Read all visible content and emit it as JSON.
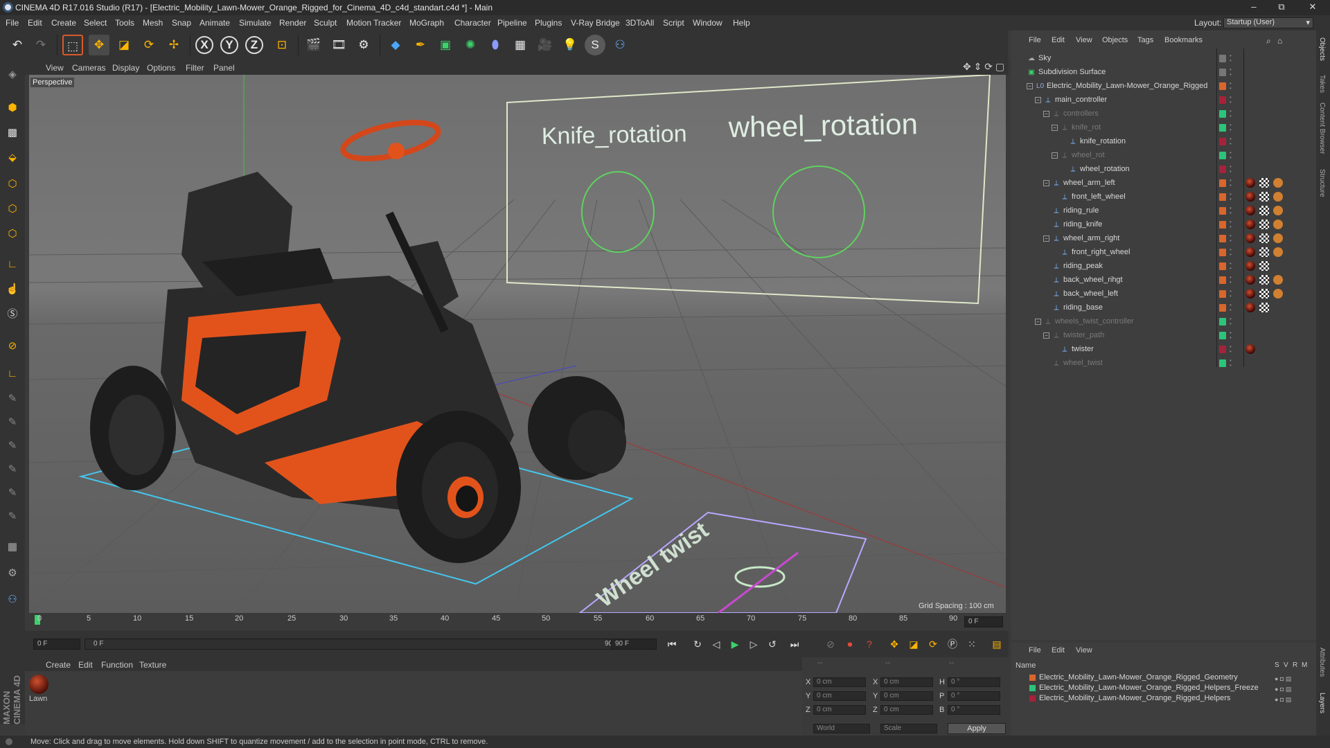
{
  "window": {
    "title": "CINEMA 4D R17.016 Studio (R17) - [Electric_Mobility_Lawn-Mower_Orange_Rigged_for_Cinema_4D_c4d_standart.c4d *] - Main",
    "minimize": "–",
    "restore": "⧉",
    "close": "✕"
  },
  "menubar": {
    "items": [
      "File",
      "Edit",
      "Create",
      "Select",
      "Tools",
      "Mesh",
      "Snap",
      "Animate",
      "Simulate",
      "Render",
      "Sculpt",
      "Motion Tracker",
      "MoGraph",
      "Character",
      "Pipeline",
      "Plugins",
      "V-Ray Bridge",
      "3DToAll",
      "Script",
      "Window",
      "Help"
    ],
    "layout_label": "Layout:",
    "layout_value": "Startup (User)"
  },
  "toolbar": {
    "undo": "↶",
    "redo": "↷",
    "axis_x": "X",
    "axis_y": "Y",
    "axis_z": "Z"
  },
  "viewport": {
    "menu": [
      "View",
      "Cameras",
      "Display",
      "Options",
      "Filter",
      "Panel"
    ],
    "label": "Perspective",
    "grid_spacing": "Grid Spacing : 100 cm",
    "scene_text_knife": "Knife_rotation",
    "scene_text_wheel": "wheel_rotation",
    "scene_text_twist": "Wheel twist"
  },
  "timeline": {
    "ticks": [
      "0",
      "5",
      "10",
      "15",
      "20",
      "25",
      "30",
      "35",
      "40",
      "45",
      "50",
      "55",
      "60",
      "65",
      "70",
      "75",
      "80",
      "85",
      "90"
    ],
    "current_frame": "0 F"
  },
  "transport": {
    "start_frame": "0 F",
    "range_start": "0 F",
    "range_end": "90 F",
    "end_frame": "90 F"
  },
  "material_manager": {
    "menu": [
      "Create",
      "Edit",
      "Function",
      "Texture"
    ],
    "materials": [
      {
        "name": "Lawn"
      }
    ]
  },
  "coordinates": {
    "header": [
      "--",
      "--",
      "--"
    ],
    "rows": [
      {
        "axis": "X",
        "pos": "0 cm",
        "size_axis": "X",
        "size": "0 cm",
        "rot_axis": "H",
        "rot": "0 °"
      },
      {
        "axis": "Y",
        "pos": "0 cm",
        "size_axis": "Y",
        "size": "0 cm",
        "rot_axis": "P",
        "rot": "0 °"
      },
      {
        "axis": "Z",
        "pos": "0 cm",
        "size_axis": "Z",
        "size": "0 cm",
        "rot_axis": "B",
        "rot": "0 °"
      }
    ],
    "mode1": "World",
    "mode2": "Scale",
    "apply": "Apply"
  },
  "object_manager": {
    "menu": [
      "File",
      "Edit",
      "View",
      "Objects",
      "Tags",
      "Bookmarks"
    ],
    "objects": [
      {
        "name": "Sky",
        "dim": false
      },
      {
        "name": "Subdivision Surface",
        "dim": false
      },
      {
        "name": "Electric_Mobility_Lawn-Mower_Orange_Rigged",
        "dim": false
      },
      {
        "name": "main_controller",
        "dim": false
      },
      {
        "name": "controllers",
        "dim": true
      },
      {
        "name": "knife_rot",
        "dim": true
      },
      {
        "name": "knife_rotation",
        "dim": false
      },
      {
        "name": "wheel_rot",
        "dim": true
      },
      {
        "name": "wheel_rotation",
        "dim": false
      },
      {
        "name": "wheel_arm_left",
        "dim": false
      },
      {
        "name": "front_left_wheel",
        "dim": false
      },
      {
        "name": "riding_rule",
        "dim": false
      },
      {
        "name": "riding_knife",
        "dim": false
      },
      {
        "name": "wheel_arm_right",
        "dim": false
      },
      {
        "name": "front_right_wheel",
        "dim": false
      },
      {
        "name": "riding_peak",
        "dim": false
      },
      {
        "name": "back_wheel_rihgt",
        "dim": false
      },
      {
        "name": "back_wheel_left",
        "dim": false
      },
      {
        "name": "riding_base",
        "dim": false
      },
      {
        "name": "wheels_twist_controller",
        "dim": true
      },
      {
        "name": "twister_path",
        "dim": true
      },
      {
        "name": "twister",
        "dim": false
      },
      {
        "name": "wheel_twist",
        "dim": true
      }
    ]
  },
  "layer_manager": {
    "menu": [
      "File",
      "Edit",
      "View"
    ],
    "header_name": "Name",
    "header_cols": [
      "S",
      "V",
      "R",
      "M"
    ],
    "layers": [
      {
        "name": "Electric_Mobility_Lawn-Mower_Orange_Rigged_Geometry",
        "color": "#d9662b"
      },
      {
        "name": "Electric_Mobility_Lawn-Mower_Orange_Rigged_Helpers_Freeze",
        "color": "#2bc47a"
      },
      {
        "name": "Electric_Mobility_Lawn-Mower_Orange_Rigged_Helpers",
        "color": "#a6223a"
      }
    ]
  },
  "right_tabs": [
    "Objects",
    "Takes",
    "Content Browser",
    "Structure",
    "Attributes",
    "Layers"
  ],
  "brand": "MAXON CINEMA 4D",
  "status": "Move: Click and drag to move elements. Hold down SHIFT to quantize movement / add to the selection in point mode, CTRL to remove."
}
